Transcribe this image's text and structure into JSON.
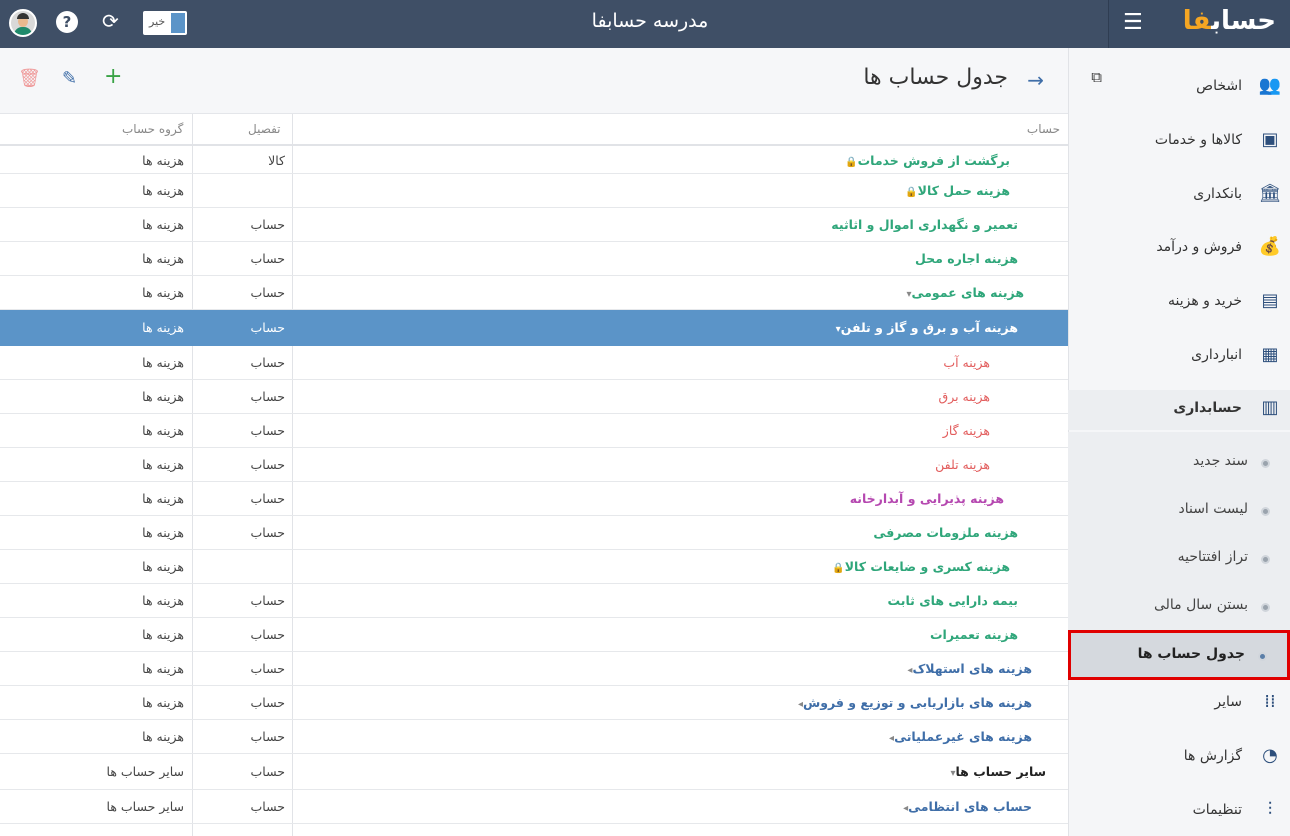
{
  "app": {
    "logo_text": "حساب",
    "logo_accent": "فا",
    "company_title": "مدرسه حسابفا",
    "toggle_label": "خیر"
  },
  "toolbar": {
    "page_title": "جدول حساب ها"
  },
  "table": {
    "headers": {
      "account": "حساب",
      "detail": "تفصیل",
      "group": "گروه حساب"
    },
    "rows": [
      {
        "name": "برگشت از فروش خدمات",
        "detail": "کالا",
        "group": "هزینه ها",
        "style": "green",
        "lock": true
      },
      {
        "name": "هزینه حمل کالا",
        "detail": "",
        "group": "هزینه ها",
        "style": "green",
        "lock": true
      },
      {
        "name": "تعمیر و نگهداری اموال و اثاثیه",
        "detail": "حساب",
        "group": "هزینه ها",
        "style": "green"
      },
      {
        "name": "هزینه اجاره محل",
        "detail": "حساب",
        "group": "هزینه ها",
        "style": "green"
      },
      {
        "name": "هزینه های عمومی",
        "detail": "حساب",
        "group": "هزینه ها",
        "style": "green",
        "expand": "down"
      },
      {
        "name": "هزینه آب و برق و گاز و تلفن",
        "detail": "حساب",
        "group": "هزینه ها",
        "style": "white",
        "expand": "down",
        "selected": true
      },
      {
        "name": "هزینه آب",
        "detail": "حساب",
        "group": "هزینه ها",
        "style": "red"
      },
      {
        "name": "هزینه برق",
        "detail": "حساب",
        "group": "هزینه ها",
        "style": "red"
      },
      {
        "name": "هزینه گاز",
        "detail": "حساب",
        "group": "هزینه ها",
        "style": "red"
      },
      {
        "name": "هزینه تلفن",
        "detail": "حساب",
        "group": "هزینه ها",
        "style": "red"
      },
      {
        "name": "هزینه پذیرایی و آبدارخانه",
        "detail": "حساب",
        "group": "هزینه ها",
        "style": "magenta"
      },
      {
        "name": "هزینه ملزومات مصرفی",
        "detail": "حساب",
        "group": "هزینه ها",
        "style": "green"
      },
      {
        "name": "هزینه کسری و ضایعات کالا",
        "detail": "",
        "group": "هزینه ها",
        "style": "green",
        "lock": true
      },
      {
        "name": "بیمه دارایی های ثابت",
        "detail": "حساب",
        "group": "هزینه ها",
        "style": "green"
      },
      {
        "name": "هزینه تعمیرات",
        "detail": "حساب",
        "group": "هزینه ها",
        "style": "green"
      },
      {
        "name": "هزینه های استهلاک",
        "detail": "حساب",
        "group": "هزینه ها",
        "style": "blue",
        "expand": "left"
      },
      {
        "name": "هزینه های بازاریابی و توزیع و فروش",
        "detail": "حساب",
        "group": "هزینه ها",
        "style": "blue",
        "expand": "left"
      },
      {
        "name": "هزینه های غیرعملیاتی",
        "detail": "حساب",
        "group": "هزینه ها",
        "style": "blue",
        "expand": "left"
      },
      {
        "name": "سایر حساب ها",
        "detail": "حساب",
        "group": "سایر حساب ها",
        "style": "black",
        "expand": "down"
      },
      {
        "name": "حساب های انتظامی",
        "detail": "حساب",
        "group": "سایر حساب ها",
        "style": "blue",
        "expand": "left"
      }
    ]
  },
  "sidebar": {
    "items": [
      {
        "label": "اشخاص",
        "icon": "people-icon"
      },
      {
        "label": "کالاها و خدمات",
        "icon": "box-icon"
      },
      {
        "label": "بانکداری",
        "icon": "bank-icon"
      },
      {
        "label": "فروش و درآمد",
        "icon": "money-hand-icon"
      },
      {
        "label": "خرید و هزینه",
        "icon": "wallet-icon"
      },
      {
        "label": "انبارداری",
        "icon": "warehouse-icon"
      },
      {
        "label": "حسابداری",
        "icon": "abacus-icon"
      }
    ],
    "subitems": [
      {
        "label": "سند جدید"
      },
      {
        "label": "لیست اسناد"
      },
      {
        "label": "تراز افتتاحیه"
      },
      {
        "label": "بستن سال مالی"
      },
      {
        "label": "جدول حساب ها"
      }
    ],
    "bottom_items": [
      {
        "label": "سایر",
        "icon": "grid-icon"
      },
      {
        "label": "گزارش ها",
        "icon": "report-icon"
      },
      {
        "label": "تنظیمات",
        "icon": "sliders-icon"
      }
    ]
  },
  "colors": {
    "topbar": "#3f4f66",
    "selected_row": "#5b94c8",
    "account_green": "#2fa67a",
    "account_blue": "#3f6ea8",
    "account_red": "#e25c5c",
    "account_magenta": "#b548b0",
    "highlight_border": "#e00000"
  }
}
